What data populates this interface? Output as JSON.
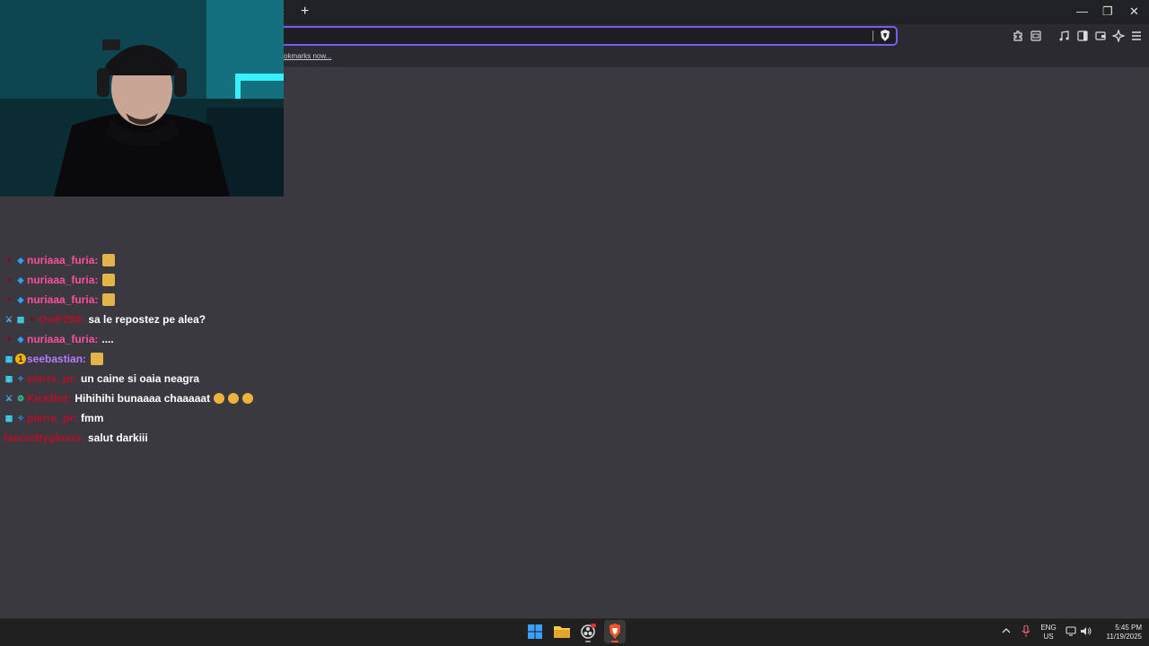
{
  "browser": {
    "back_glyph": "‹",
    "new_tab_glyph": "+",
    "minimize_glyph": "—",
    "restore_glyph": "❐",
    "close_glyph": "✕",
    "bookmarks_prompt": "okmarks now...",
    "accent_color": "#7f5af0"
  },
  "chat": {
    "messages": [
      {
        "user": "nuriaaa_furia:",
        "user_color": "#ff4f9a",
        "text": "",
        "badges": [
          "red-mark",
          "blue-cube"
        ],
        "emojis": 1
      },
      {
        "user": "nuriaaa_furia:",
        "user_color": "#ff4f9a",
        "text": "",
        "badges": [
          "red-mark",
          "blue-cube"
        ],
        "emojis": 1
      },
      {
        "user": "nuriaaa_furia:",
        "user_color": "#ff4f9a",
        "text": "",
        "badges": [
          "red-mark",
          "blue-cube"
        ],
        "emojis": 1
      },
      {
        "user": "OviP208:",
        "user_color": "#b3102b",
        "text": "sa le repostez pe alea?",
        "badges": [
          "sword",
          "box-badge",
          "red-mark"
        ],
        "emojis": 0
      },
      {
        "user": "nuriaaa_furia:",
        "user_color": "#ff4f9a",
        "text": "....",
        "badges": [
          "red-mark",
          "blue-cube"
        ],
        "emojis": 0
      },
      {
        "user": "seebastian:",
        "user_color": "#b77cff",
        "text": "",
        "badges": [
          "box-badge",
          "gold-one"
        ],
        "emojis": 1
      },
      {
        "user": "pierre_pr:",
        "user_color": "#b3102b",
        "text": "un caine si oaia neagra",
        "badges": [
          "box-badge",
          "blue-star"
        ],
        "emojis": 0
      },
      {
        "user": "KickBot:",
        "user_color": "#b3102b",
        "text": "Hihihihi bunaaaa chaaaaat",
        "badges": [
          "sword",
          "green-gear"
        ],
        "emojis": 3
      },
      {
        "user": "pierre_pr:",
        "user_color": "#b3102b",
        "text": "fmm",
        "badges": [
          "box-badge",
          "blue-star"
        ],
        "emojis": 0
      },
      {
        "user": "fancinftyglmon:",
        "user_color": "#b3102b",
        "text": "salut darkiii",
        "badges": [],
        "emojis": 0
      }
    ]
  },
  "tray": {
    "lang_top": "ENG",
    "lang_bottom": "US",
    "time": "5:45 PM",
    "date": "11/19/2025"
  }
}
